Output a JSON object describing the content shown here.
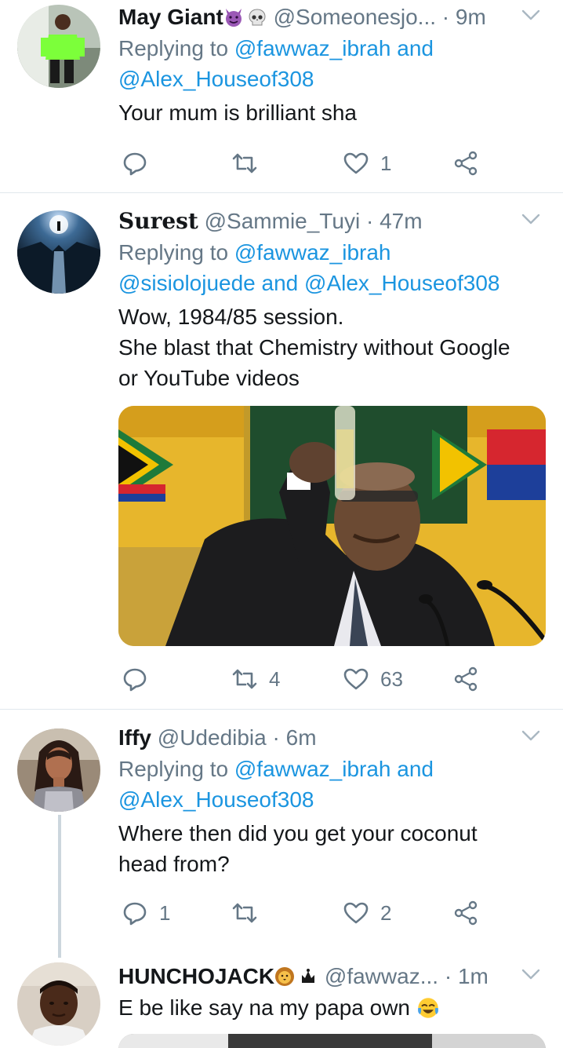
{
  "tweets": [
    {
      "name": "May Giant",
      "name_emojis": [
        "smiling-devil-emoji",
        "skull-emoji"
      ],
      "handle": "@Someonesjo...",
      "dot": "·",
      "time": "9m",
      "replying_prefix": "Replying to",
      "replying_mention1": "@fawwaz_ibrah",
      "replying_and": "and",
      "replying_mention2": "@Alex_Houseof308",
      "text": "Your mum is brilliant sha",
      "reply_count": "",
      "retweet_count": "",
      "like_count": "1"
    },
    {
      "name": "Surest",
      "handle": "@Sammie_Tuyi",
      "dot": "·",
      "time": "47m",
      "replying_prefix": "Replying to",
      "replying_mention1": "@fawwaz_ibrah",
      "replying_mention2": "@sisiolojuede",
      "replying_and": "and",
      "replying_mention3": "@Alex_Houseof308",
      "text_lines": [
        "Wow, 1984/85 session.",
        "She blast that Chemistry without Google",
        "or YouTube videos"
      ],
      "media": "photo-man-raising-glass",
      "reply_count": "",
      "retweet_count": "4",
      "like_count": "63"
    },
    {
      "name": "Iffy",
      "handle": "@Udedibia",
      "dot": "·",
      "time": "6m",
      "replying_prefix": "Replying to",
      "replying_mention1": "@fawwaz_ibrah",
      "replying_and": "and",
      "replying_mention2": "@Alex_Houseof308",
      "text_lines": [
        "Where then did you get your coconut",
        "head from?"
      ],
      "reply_count": "1",
      "retweet_count": "",
      "like_count": "2"
    },
    {
      "name": "HUNCHOJACK",
      "name_emojis": [
        "lion-emoji",
        "crown-emoji"
      ],
      "handle": "@fawwaz...",
      "dot": "·",
      "time": "1m",
      "text": "E be like say na my papa own",
      "text_emoji": "tears-of-joy-emoji"
    }
  ],
  "colors": {
    "link": "#1b95e0",
    "secondary": "#657786",
    "divider": "#e1e8ed",
    "thread_line": "#ccd6dd"
  }
}
